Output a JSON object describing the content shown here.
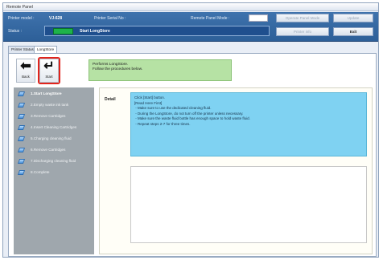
{
  "window": {
    "title": "Remote Panel"
  },
  "header": {
    "printer_model_label": "Printer model :",
    "printer_model_value": "VJ-628",
    "serial_label": "Printer Serial No :",
    "remote_mode_label": "Remote Panel Mode :",
    "status_label": "Status :",
    "status_text": "Start LongStore",
    "status_color": "#1eb34a",
    "buttons": {
      "operation_mode": "Operate Panel Mode",
      "update": "Update",
      "printer_info": "Printer info",
      "exit": "Exit"
    }
  },
  "tabs": [
    {
      "label": "Printer Status"
    },
    {
      "label": "LongStore"
    }
  ],
  "toolbar": {
    "back_label": "Back",
    "start_label": "Start"
  },
  "notice": {
    "line1": "Performs LongStore.",
    "line2": "Follow the procedures below."
  },
  "steps": [
    {
      "label": "1.Start LongStore"
    },
    {
      "label": "2.Empty waste ink tank"
    },
    {
      "label": "3.Remove Cartridges"
    },
    {
      "label": "4.Insert Cleaning Cartridges"
    },
    {
      "label": "5.Charging cleaning fluid"
    },
    {
      "label": "6.Remove Cartridges"
    },
    {
      "label": "7.Discharging cleaning fluid"
    },
    {
      "label": "8.Complete"
    }
  ],
  "detail": {
    "label": "Detail",
    "lines": [
      "Click [Start] button.",
      "",
      "[Read Here First]",
      " - Make sure to use the dedicated cleaning fluid.",
      " - During the LongStore, do not turn off the printer unless necessary.",
      " - Make sure the waste fluid bottle has enough space to hold waste fluid.",
      " - Repeat steps 2-7 for three times."
    ]
  }
}
